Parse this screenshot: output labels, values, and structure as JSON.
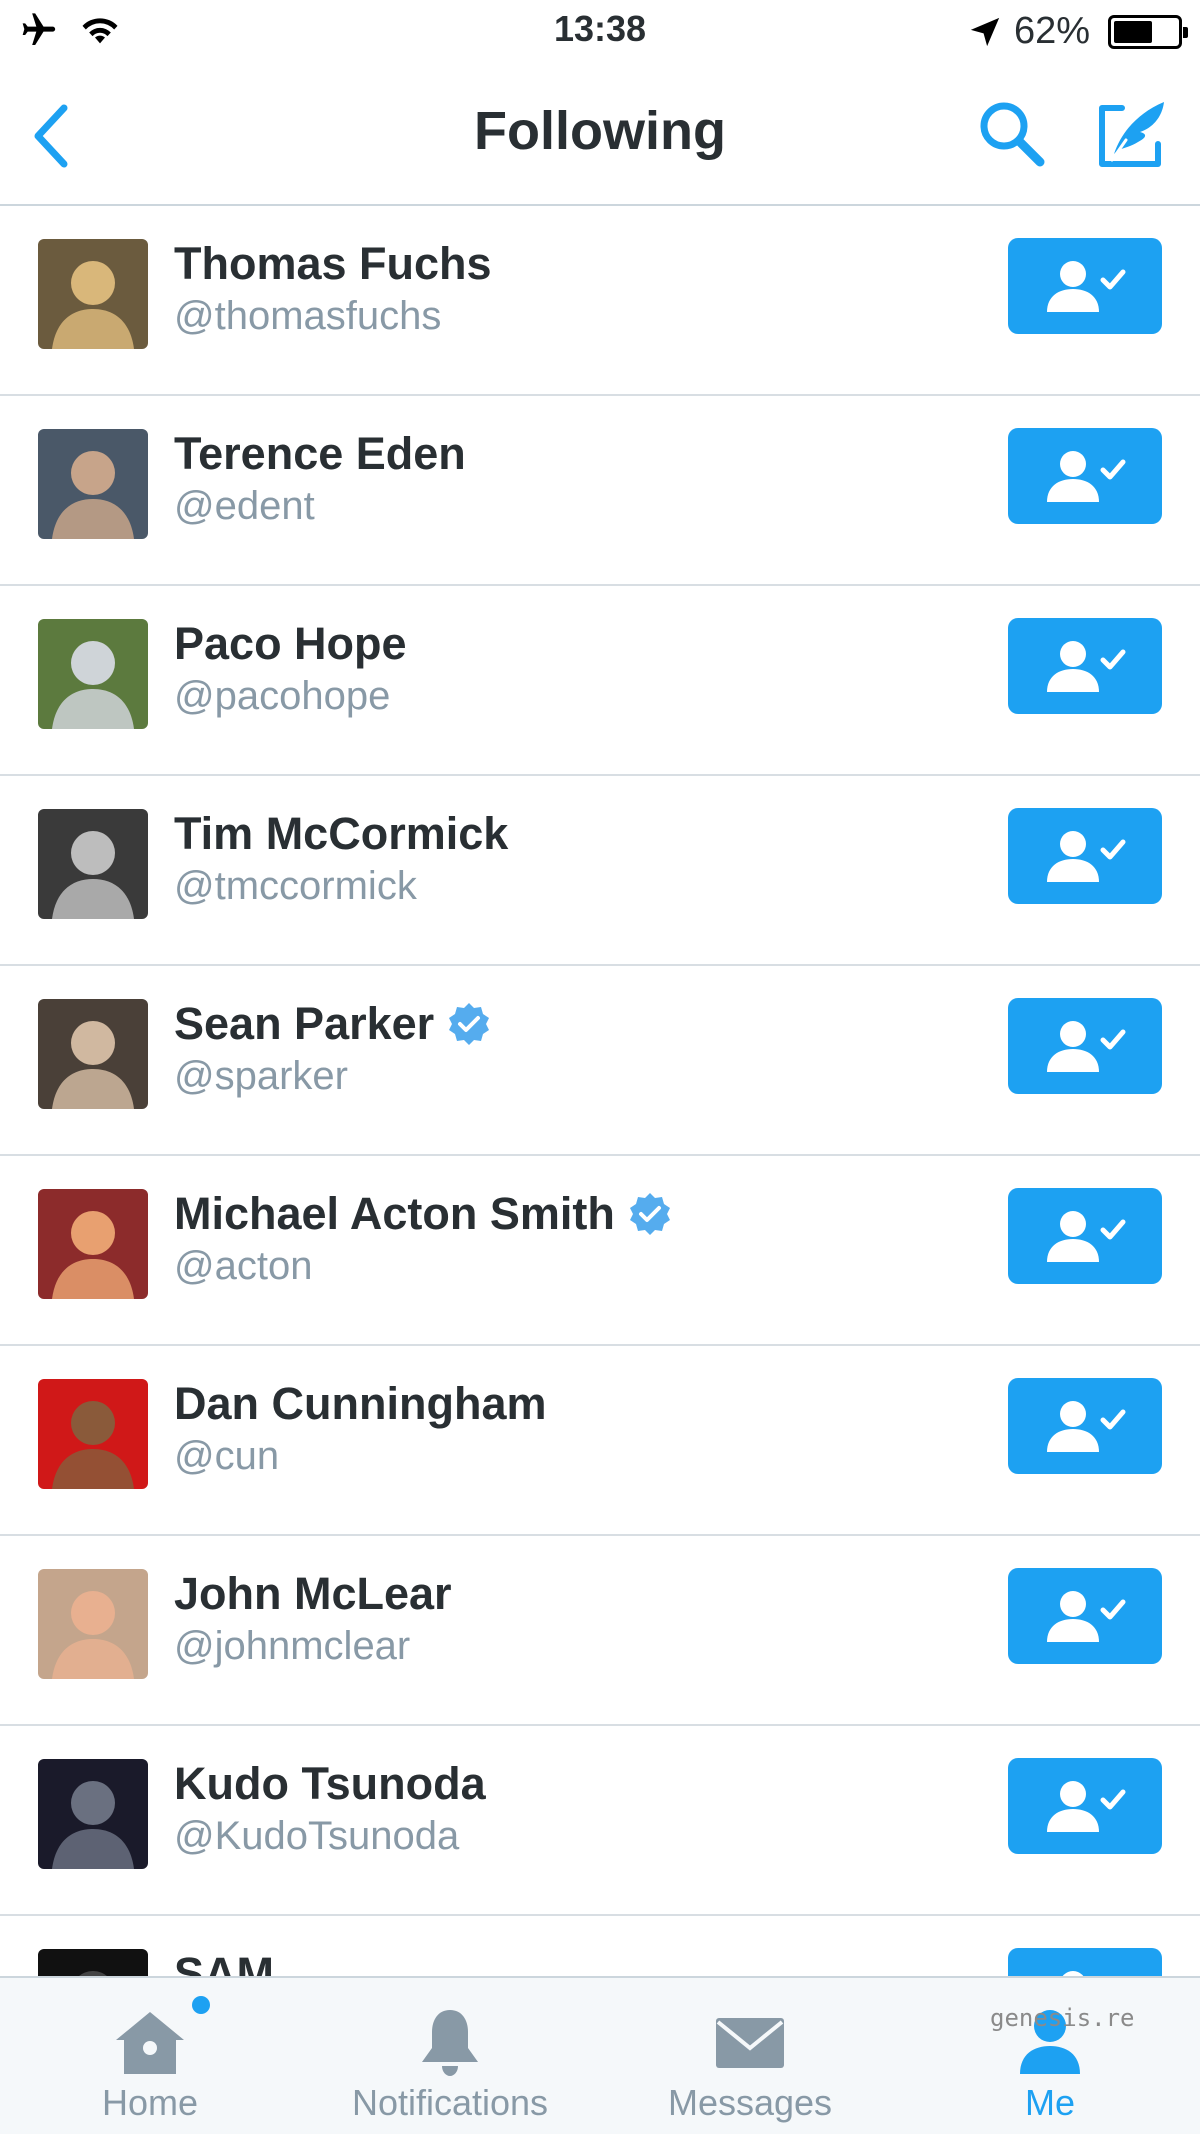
{
  "status_bar": {
    "time": "13:38",
    "battery_text": "62%",
    "battery_level": 0.62,
    "icons": [
      "airplane-icon",
      "wifi-icon",
      "location-arrow-icon",
      "battery-icon"
    ]
  },
  "nav": {
    "title": "Following",
    "back_icon": "chevron-left-icon",
    "search_icon": "search-icon",
    "compose_icon": "compose-icon"
  },
  "accent_color": "#1da1f2",
  "users": [
    {
      "name": "Thomas Fuchs",
      "handle": "@thomasfuchs",
      "verified": false
    },
    {
      "name": "Terence Eden",
      "handle": "@edent",
      "verified": false
    },
    {
      "name": "Paco Hope",
      "handle": "@pacohope",
      "verified": false
    },
    {
      "name": "Tim McCormick",
      "handle": "@tmccormick",
      "verified": false
    },
    {
      "name": "Sean Parker",
      "handle": "@sparker",
      "verified": true
    },
    {
      "name": "Michael Acton Smith",
      "handle": "@acton",
      "verified": true
    },
    {
      "name": "Dan Cunningham",
      "handle": "@cun",
      "verified": false
    },
    {
      "name": "John McLear",
      "handle": "@johnmclear",
      "verified": false
    },
    {
      "name": "Kudo Tsunoda",
      "handle": "@KudoTsunoda",
      "verified": false
    },
    {
      "name": "SAM",
      "handle": "",
      "verified": false
    }
  ],
  "tabs": [
    {
      "label": "Home",
      "icon": "home-icon",
      "active": false,
      "badge_dot": true
    },
    {
      "label": "Notifications",
      "icon": "bell-icon",
      "active": false,
      "badge_dot": false
    },
    {
      "label": "Messages",
      "icon": "envelope-icon",
      "active": false,
      "badge_dot": false
    },
    {
      "label": "Me",
      "icon": "person-icon",
      "active": true,
      "badge_dot": false
    }
  ],
  "watermark": "genesis.re"
}
